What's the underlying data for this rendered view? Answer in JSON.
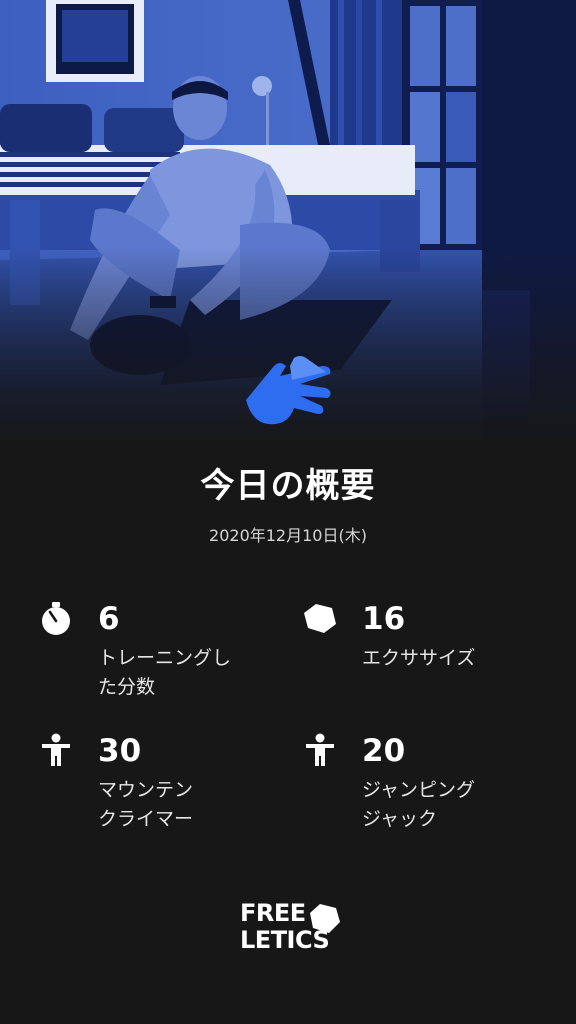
{
  "colors": {
    "background": "#171717",
    "accent": "#2f6df0",
    "photo_tint": "#1b3a8f"
  },
  "hero": {
    "icon": "hand-icon",
    "alt": "athlete stretching on a mat in a bedroom"
  },
  "summary": {
    "title": "今日の概要",
    "date": "2020年12月10日(木)"
  },
  "stats": [
    {
      "icon": "stopwatch-icon",
      "value": "6",
      "label_line1": "トレーニングし",
      "label_line2": "た分数"
    },
    {
      "icon": "exercise-gem-icon",
      "value": "16",
      "label_line1": "エクササイズ",
      "label_line2": ""
    },
    {
      "icon": "person-icon",
      "value": "30",
      "label_line1": "マウンテン",
      "label_line2": "クライマー"
    },
    {
      "icon": "person-icon",
      "value": "20",
      "label_line1": "ジャンピング",
      "label_line2": "ジャック"
    }
  ],
  "brand": {
    "line1": "FREE",
    "line2": "LETICS"
  }
}
